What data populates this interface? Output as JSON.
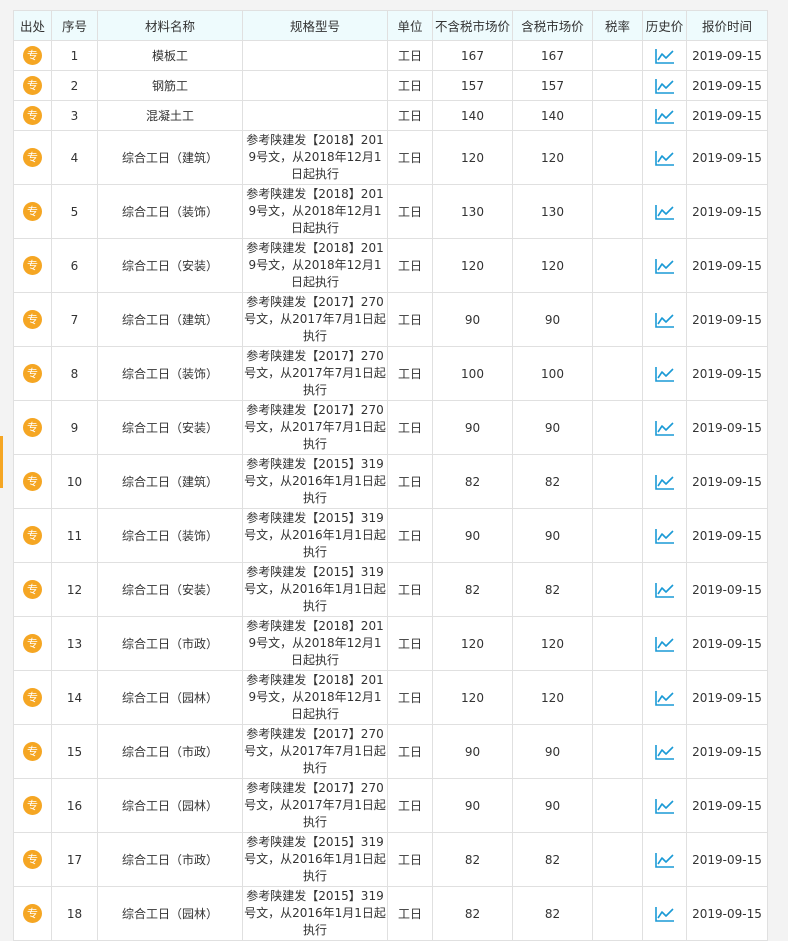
{
  "table": {
    "headers": [
      "出处",
      "序号",
      "材料名称",
      "规格型号",
      "单位",
      "不含税市场价",
      "含税市场价",
      "税率",
      "历史价",
      "报价时间"
    ],
    "badge_label": "专",
    "rows": [
      {
        "no": "1",
        "name": "模板工",
        "spec": "",
        "unit": "工日",
        "price_ex": "167",
        "price_inc": "167",
        "tax": "",
        "date": "2019-09-15"
      },
      {
        "no": "2",
        "name": "钢筋工",
        "spec": "",
        "unit": "工日",
        "price_ex": "157",
        "price_inc": "157",
        "tax": "",
        "date": "2019-09-15"
      },
      {
        "no": "3",
        "name": "混凝土工",
        "spec": "",
        "unit": "工日",
        "price_ex": "140",
        "price_inc": "140",
        "tax": "",
        "date": "2019-09-15"
      },
      {
        "no": "4",
        "name": "综合工日（建筑）",
        "spec": "参考陕建发【2018】2019号文，从2018年12月1日起执行",
        "unit": "工日",
        "price_ex": "120",
        "price_inc": "120",
        "tax": "",
        "date": "2019-09-15"
      },
      {
        "no": "5",
        "name": "综合工日（装饰）",
        "spec": "参考陕建发【2018】2019号文，从2018年12月1日起执行",
        "unit": "工日",
        "price_ex": "130",
        "price_inc": "130",
        "tax": "",
        "date": "2019-09-15"
      },
      {
        "no": "6",
        "name": "综合工日（安装）",
        "spec": "参考陕建发【2018】2019号文，从2018年12月1日起执行",
        "unit": "工日",
        "price_ex": "120",
        "price_inc": "120",
        "tax": "",
        "date": "2019-09-15"
      },
      {
        "no": "7",
        "name": "综合工日（建筑）",
        "spec": "参考陕建发【2017】270号文，从2017年7月1日起执行",
        "unit": "工日",
        "price_ex": "90",
        "price_inc": "90",
        "tax": "",
        "date": "2019-09-15"
      },
      {
        "no": "8",
        "name": "综合工日（装饰）",
        "spec": "参考陕建发【2017】270号文，从2017年7月1日起执行",
        "unit": "工日",
        "price_ex": "100",
        "price_inc": "100",
        "tax": "",
        "date": "2019-09-15"
      },
      {
        "no": "9",
        "name": "综合工日（安装）",
        "spec": "参考陕建发【2017】270号文，从2017年7月1日起执行",
        "unit": "工日",
        "price_ex": "90",
        "price_inc": "90",
        "tax": "",
        "date": "2019-09-15"
      },
      {
        "no": "10",
        "name": "综合工日（建筑）",
        "spec": "参考陕建发【2015】319号文，从2016年1月1日起执行",
        "unit": "工日",
        "price_ex": "82",
        "price_inc": "82",
        "tax": "",
        "date": "2019-09-15"
      },
      {
        "no": "11",
        "name": "综合工日（装饰）",
        "spec": "参考陕建发【2015】319号文，从2016年1月1日起执行",
        "unit": "工日",
        "price_ex": "90",
        "price_inc": "90",
        "tax": "",
        "date": "2019-09-15"
      },
      {
        "no": "12",
        "name": "综合工日（安装）",
        "spec": "参考陕建发【2015】319号文，从2016年1月1日起执行",
        "unit": "工日",
        "price_ex": "82",
        "price_inc": "82",
        "tax": "",
        "date": "2019-09-15"
      },
      {
        "no": "13",
        "name": "综合工日（市政）",
        "spec": "参考陕建发【2018】2019号文，从2018年12月1日起执行",
        "unit": "工日",
        "price_ex": "120",
        "price_inc": "120",
        "tax": "",
        "date": "2019-09-15"
      },
      {
        "no": "14",
        "name": "综合工日（园林）",
        "spec": "参考陕建发【2018】2019号文，从2018年12月1日起执行",
        "unit": "工日",
        "price_ex": "120",
        "price_inc": "120",
        "tax": "",
        "date": "2019-09-15"
      },
      {
        "no": "15",
        "name": "综合工日（市政）",
        "spec": "参考陕建发【2017】270号文，从2017年7月1日起执行",
        "unit": "工日",
        "price_ex": "90",
        "price_inc": "90",
        "tax": "",
        "date": "2019-09-15"
      },
      {
        "no": "16",
        "name": "综合工日（园林）",
        "spec": "参考陕建发【2017】270号文，从2017年7月1日起执行",
        "unit": "工日",
        "price_ex": "90",
        "price_inc": "90",
        "tax": "",
        "date": "2019-09-15"
      },
      {
        "no": "17",
        "name": "综合工日（市政）",
        "spec": "参考陕建发【2015】319号文，从2016年1月1日起执行",
        "unit": "工日",
        "price_ex": "82",
        "price_inc": "82",
        "tax": "",
        "date": "2019-09-15"
      },
      {
        "no": "18",
        "name": "综合工日（园林）",
        "spec": "参考陕建发【2015】319号文，从2016年1月1日起执行",
        "unit": "工日",
        "price_ex": "82",
        "price_inc": "82",
        "tax": "",
        "date": "2019-09-15"
      }
    ]
  },
  "colors": {
    "header_bg": "#eefbfd",
    "badge": "#f5a623",
    "chart_icon": "#1a9ad6",
    "border": "#e0e0e0"
  },
  "icons": {
    "source_badge": "source-badge",
    "history": "line-chart-icon"
  }
}
